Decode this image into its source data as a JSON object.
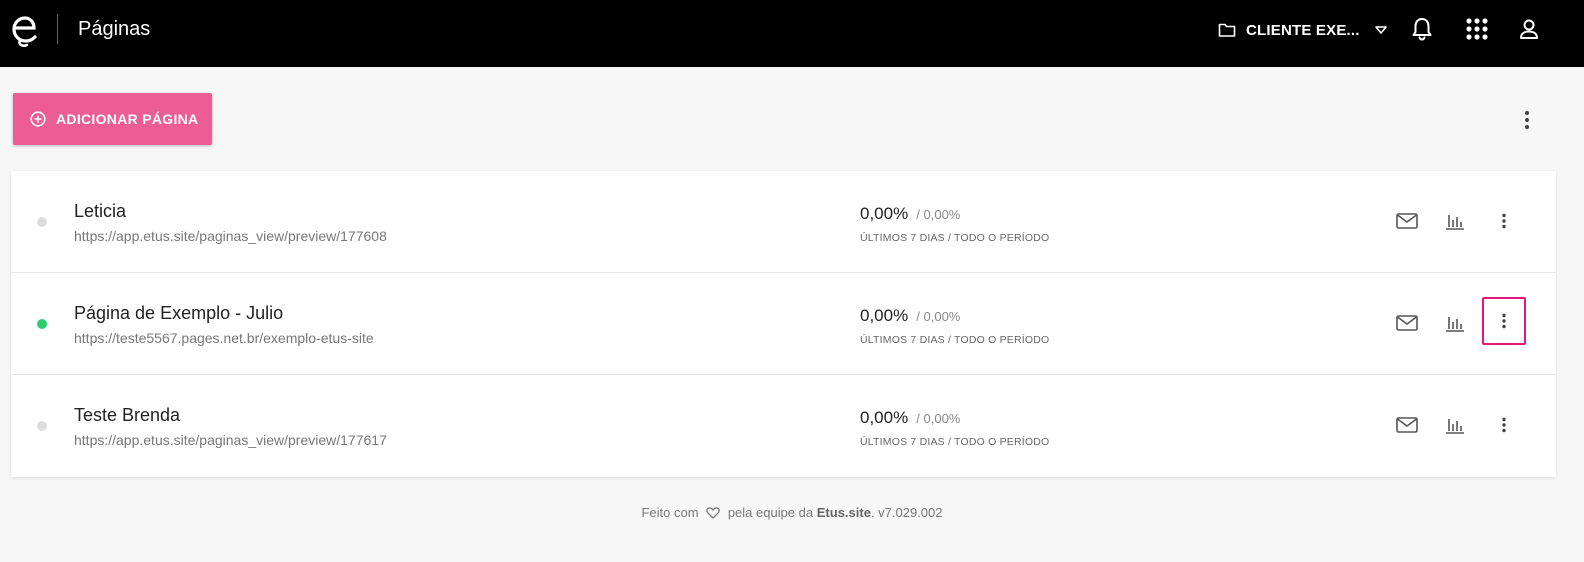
{
  "header": {
    "title": "Páginas",
    "client": "CLIENTE EXE...",
    "icons": {
      "logo": "etus-logo",
      "folder": "folder-icon",
      "caret": "caret-down-icon",
      "bell": "bell-icon",
      "apps": "apps-grid-icon",
      "user": "user-icon"
    }
  },
  "toolbar": {
    "add_label": "ADICIONAR PÁGINA",
    "add_icon": "add-circle-icon",
    "menu_icon": "more-vertical-icon"
  },
  "pages": [
    {
      "title": "Leticia",
      "url": "https://app.etus.site/paginas_view/preview/177608",
      "status": "inactive",
      "status_color": "#dddddd",
      "rate_7d": "0,00%",
      "rate_all": "0,00%",
      "caption": "ÚLTIMOS 7 DIAS / TODO O PERÍODO"
    },
    {
      "title": "Página de Exemplo - Julio",
      "url": "https://teste5567.pages.net.br/exemplo-etus-site",
      "status": "active",
      "status_color": "#2ecc71",
      "rate_7d": "0,00%",
      "rate_all": "0,00%",
      "caption": "ÚLTIMOS 7 DIAS / TODO O PERÍODO"
    },
    {
      "title": "Teste Brenda",
      "url": "https://app.etus.site/paginas_view/preview/177617",
      "status": "inactive",
      "status_color": "#dddddd",
      "rate_7d": "0,00%",
      "rate_all": "0,00%",
      "caption": "ÚLTIMOS 7 DIAS / TODO O PERÍODO"
    }
  ],
  "footer": {
    "prefix": "Feito com",
    "middle": "pela equipe da",
    "brand": "Etus.site",
    "version": ". v7.029.002"
  },
  "colors": {
    "accent": "#ec5d93",
    "highlight": "#e8157a",
    "active": "#2ecc71",
    "inactive": "#dddddd",
    "topbar": "#000000"
  }
}
